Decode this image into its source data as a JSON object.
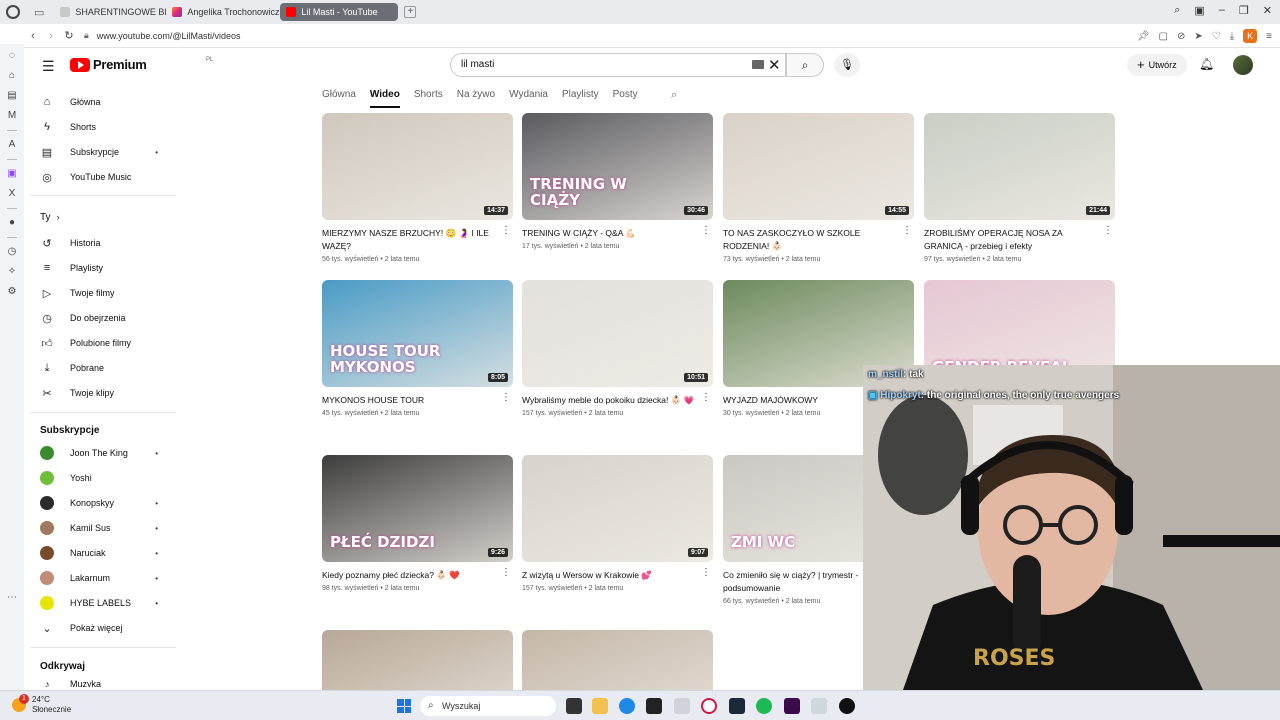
{
  "browser": {
    "tabs": [
      {
        "label": "SHARENTINGOWE BINGO"
      },
      {
        "label": "Angelika Trochonowicz (@"
      },
      {
        "label": "Lil Masti - YouTube"
      }
    ],
    "url": "www.youtube.com/@LilMasti/videos",
    "profile_initial": "K"
  },
  "youtube": {
    "logo_text": "Premium",
    "logo_region": "PL",
    "search_value": "lil masti",
    "create_label": "Utwórz",
    "channel_tabs": [
      "Główna",
      "Wideo",
      "Shorts",
      "Na żywo",
      "Wydania",
      "Playlisty",
      "Posty"
    ],
    "active_tab": "Wideo"
  },
  "sidebar": {
    "main": [
      {
        "label": "Główna",
        "icon": "home-icon"
      },
      {
        "label": "Shorts",
        "icon": "shorts-icon"
      },
      {
        "label": "Subskrypcje",
        "icon": "subscriptions-icon"
      },
      {
        "label": "YouTube Music",
        "icon": "music-icon"
      }
    ],
    "you_heading": "Ty",
    "you": [
      {
        "label": "Historia",
        "icon": "history-icon"
      },
      {
        "label": "Playlisty",
        "icon": "playlist-icon"
      },
      {
        "label": "Twoje filmy",
        "icon": "your-videos-icon"
      },
      {
        "label": "Do obejrzenia",
        "icon": "watch-later-icon"
      },
      {
        "label": "Polubione filmy",
        "icon": "like-icon"
      },
      {
        "label": "Pobrane",
        "icon": "download-icon"
      },
      {
        "label": "Twoje klipy",
        "icon": "clips-icon"
      }
    ],
    "subs_heading": "Subskrypcje",
    "subs": [
      {
        "label": "Joon The King",
        "color": "#3c8a2e"
      },
      {
        "label": "Yoshi",
        "color": "#6fbf3a"
      },
      {
        "label": "Konopskyy",
        "color": "#2b2b2b"
      },
      {
        "label": "Kamil Sus",
        "color": "#a07a60"
      },
      {
        "label": "Naruciak",
        "color": "#7b4a2a"
      },
      {
        "label": "Lakarnum",
        "color": "#c38b7a"
      },
      {
        "label": "HYBE LABELS",
        "color": "#e5e500"
      }
    ],
    "show_more": "Pokaż więcej",
    "explore_heading": "Odkrywaj",
    "explore_first": "Muzyka"
  },
  "videos": [
    {
      "title": "MIERZYMY NASZE BRZUCHY! 😳 🤰 I ILE WAŻĘ?",
      "meta": "56 tys. wyświetleń • 2 lata temu",
      "duration": "14:37",
      "bg": "#cfc8bd",
      "overlay": ""
    },
    {
      "title": "TRENING W CIĄŻY - Q&A 💪🏻",
      "meta": "17 tys. wyświetleń • 2 lata temu",
      "duration": "30:46",
      "bg": "#5a5a5f",
      "overlay": "TRENING W CIĄŻY"
    },
    {
      "title": "TO NAS ZASKOCZYŁO W SZKOLE RODZENIA! 👶🏻",
      "meta": "73 tys. wyświetleń • 2 lata temu",
      "duration": "14:55",
      "bg": "#d9d2c8",
      "overlay": ""
    },
    {
      "title": "ZROBILIŚMY OPERACJĘ NOSA ZA GRANICĄ - przebieg i efekty",
      "meta": "97 tys. wyświetleń • 2 lata temu",
      "duration": "21:44",
      "bg": "#c9cfc6",
      "overlay": ""
    },
    {
      "title": "MYKONOS HOUSE TOUR",
      "meta": "45 tys. wyświetleń • 2 lata temu",
      "duration": "8:05",
      "bg": "#4a9bc6",
      "overlay": "HOUSE TOUR MYKONOS"
    },
    {
      "title": "Wybraliśmy meble do pokoiku dziecka! 👶🏻 💗",
      "meta": "157 tys. wyświetleń • 2 lata temu",
      "duration": "10:51",
      "bg": "#e4e1dd",
      "overlay": ""
    },
    {
      "title": "WYJAZD MAJÓWKOWY",
      "meta": "30 tys. wyświetleń • 2 lata temu",
      "duration": "",
      "bg": "#6d8a5c",
      "overlay": ""
    },
    {
      "title": "GENDER REVEAL",
      "meta": "",
      "duration": "10:41",
      "bg": "#e6c7d4",
      "overlay": "GENDER REVEAL"
    },
    {
      "title": "Kiedy poznamy płeć dziecka? 👶🏻 ❤️",
      "meta": "98 tys. wyświetleń • 2 lata temu",
      "duration": "9:26",
      "bg": "#3d3d3d",
      "overlay": "PŁEĆ DZIDZI"
    },
    {
      "title": "Z wizytą u Wersow w Krakowie 💕",
      "meta": "157 tys. wyświetleń • 2 lata temu",
      "duration": "9:07",
      "bg": "#d8d3cc",
      "overlay": ""
    },
    {
      "title": "Co zmieniło się w ciąży? | trymestr - podsumowanie",
      "meta": "66 tys. wyświetleń • 2 lata temu",
      "duration": "",
      "bg": "#cbc8c3",
      "overlay": "ZMI WC"
    },
    {
      "title": "",
      "meta": "",
      "duration": "",
      "bg": "#d6cfc6",
      "overlay": ""
    },
    {
      "title": "",
      "meta": "",
      "duration": "",
      "bg": "#b8a898",
      "overlay": ""
    },
    {
      "title": "",
      "meta": "",
      "duration": "",
      "bg": "#c4b7a8",
      "overlay": ""
    }
  ],
  "stream_chat": [
    {
      "user": "m_nstil",
      "message": ": tak"
    },
    {
      "user": "Hipokryt",
      "message": ": the original ones, the only true avengers"
    }
  ],
  "taskbar": {
    "weather_temp": "24°C",
    "weather_desc": "Słonecznie",
    "notification_count": "1",
    "search_placeholder": "Wyszukaj"
  }
}
